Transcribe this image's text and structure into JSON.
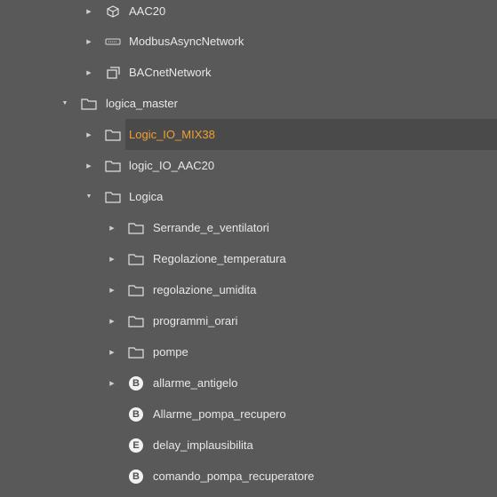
{
  "tree": {
    "expanded_arrow": "▼",
    "collapsed_arrow": "▶",
    "rows": [
      {
        "label": "AAC20",
        "icon": "device-icon",
        "arrow": "collapsed"
      },
      {
        "label": "ModbusAsyncNetwork",
        "icon": "network-port-icon",
        "arrow": "collapsed"
      },
      {
        "label": "BACnetNetwork",
        "icon": "bacnet-network-icon",
        "arrow": "collapsed"
      },
      {
        "label": "logica_master",
        "icon": "folder-icon",
        "arrow": "expanded"
      },
      {
        "label": "Logic_IO_MIX38",
        "icon": "folder-icon",
        "arrow": "collapsed",
        "selected": true
      },
      {
        "label": "logic_IO_AAC20",
        "icon": "folder-icon",
        "arrow": "collapsed"
      },
      {
        "label": "Logica",
        "icon": "folder-icon",
        "arrow": "expanded"
      },
      {
        "label": "Serrande_e_ventilatori",
        "icon": "folder-icon",
        "arrow": "collapsed"
      },
      {
        "label": "Regolazione_temperatura",
        "icon": "folder-icon",
        "arrow": "collapsed"
      },
      {
        "label": "regolazione_umidita",
        "icon": "folder-icon",
        "arrow": "collapsed"
      },
      {
        "label": "programmi_orari",
        "icon": "folder-icon",
        "arrow": "collapsed"
      },
      {
        "label": "pompe",
        "icon": "folder-icon",
        "arrow": "collapsed"
      },
      {
        "label": "allarme_antigelo",
        "icon": "boolean-point-icon",
        "badge": "B",
        "arrow": "collapsed"
      },
      {
        "label": "Allarme_pompa_recupero",
        "icon": "boolean-point-icon",
        "badge": "B",
        "arrow": "none"
      },
      {
        "label": "delay_implausibilita",
        "icon": "enum-point-icon",
        "badge": "E",
        "arrow": "none"
      },
      {
        "label": "comando_pompa_recuperatore",
        "icon": "boolean-point-icon",
        "badge": "B",
        "arrow": "none"
      }
    ]
  },
  "colors": {
    "background": "#595959",
    "selected_row": "#4a4a4a",
    "selected_text": "#f0a030",
    "text": "#e8e8e8"
  }
}
